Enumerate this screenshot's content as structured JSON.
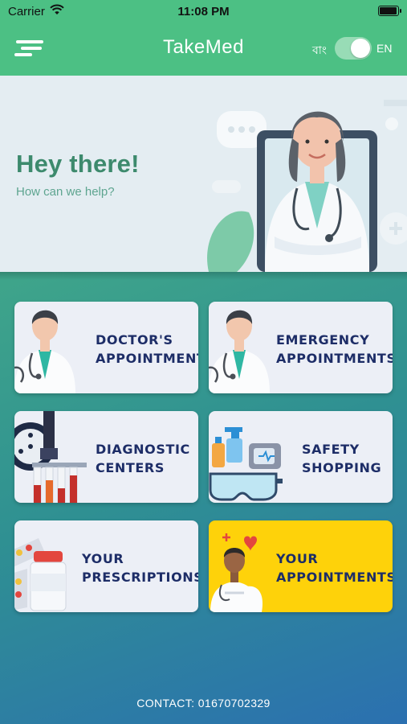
{
  "status_bar": {
    "carrier": "Carrier",
    "time": "11:08 PM"
  },
  "nav": {
    "title": "TakeMed",
    "lang_bn": "বাং",
    "lang_en": "EN",
    "language_toggle_on": true
  },
  "hero": {
    "heading": "Hey there!",
    "subheading": "How can we help?"
  },
  "cards": [
    {
      "line1": "DOCTOR'S",
      "line2": "APPOINTMENT"
    },
    {
      "line1": "EMERGENCY",
      "line2": "APPOINTMENTS"
    },
    {
      "line1": "DIAGNOSTIC",
      "line2": "CENTERS"
    },
    {
      "line1": "SAFETY",
      "line2": "SHOPPING"
    },
    {
      "line1": "YOUR",
      "line2": "PRESCRIPTIONS"
    },
    {
      "line1": "YOUR",
      "line2": "APPOINTMENTS"
    }
  ],
  "footer": {
    "contact": "CONTACT: 01670702329"
  },
  "colors": {
    "header_green": "#4cc084",
    "card_bg": "#eceff6",
    "highlight_card": "#fed20a",
    "label_navy": "#1d2d67",
    "hero_heading": "#3d8a6d"
  },
  "icons": [
    "wifi-icon",
    "battery-icon",
    "menu-icon",
    "doctor-icon",
    "microscope-icon",
    "sanitizer-icon",
    "medicine-icon",
    "calendar-doctor-icon"
  ]
}
